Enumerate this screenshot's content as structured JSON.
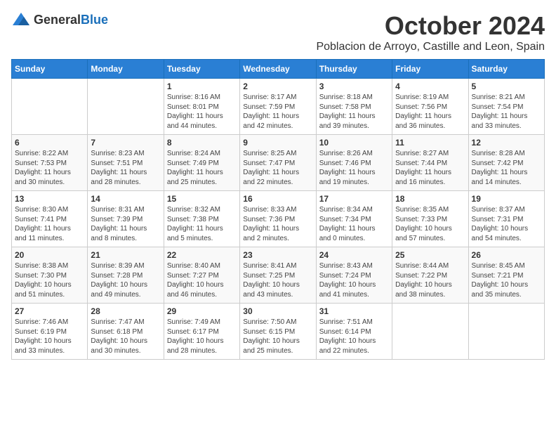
{
  "header": {
    "logo": {
      "general": "General",
      "blue": "Blue"
    },
    "month": "October 2024",
    "location": "Poblacion de Arroyo, Castille and Leon, Spain"
  },
  "weekdays": [
    "Sunday",
    "Monday",
    "Tuesday",
    "Wednesday",
    "Thursday",
    "Friday",
    "Saturday"
  ],
  "weeks": [
    [
      {
        "day": "",
        "info": ""
      },
      {
        "day": "",
        "info": ""
      },
      {
        "day": "1",
        "info": "Sunrise: 8:16 AM\nSunset: 8:01 PM\nDaylight: 11 hours\nand 44 minutes."
      },
      {
        "day": "2",
        "info": "Sunrise: 8:17 AM\nSunset: 7:59 PM\nDaylight: 11 hours\nand 42 minutes."
      },
      {
        "day": "3",
        "info": "Sunrise: 8:18 AM\nSunset: 7:58 PM\nDaylight: 11 hours\nand 39 minutes."
      },
      {
        "day": "4",
        "info": "Sunrise: 8:19 AM\nSunset: 7:56 PM\nDaylight: 11 hours\nand 36 minutes."
      },
      {
        "day": "5",
        "info": "Sunrise: 8:21 AM\nSunset: 7:54 PM\nDaylight: 11 hours\nand 33 minutes."
      }
    ],
    [
      {
        "day": "6",
        "info": "Sunrise: 8:22 AM\nSunset: 7:53 PM\nDaylight: 11 hours\nand 30 minutes."
      },
      {
        "day": "7",
        "info": "Sunrise: 8:23 AM\nSunset: 7:51 PM\nDaylight: 11 hours\nand 28 minutes."
      },
      {
        "day": "8",
        "info": "Sunrise: 8:24 AM\nSunset: 7:49 PM\nDaylight: 11 hours\nand 25 minutes."
      },
      {
        "day": "9",
        "info": "Sunrise: 8:25 AM\nSunset: 7:47 PM\nDaylight: 11 hours\nand 22 minutes."
      },
      {
        "day": "10",
        "info": "Sunrise: 8:26 AM\nSunset: 7:46 PM\nDaylight: 11 hours\nand 19 minutes."
      },
      {
        "day": "11",
        "info": "Sunrise: 8:27 AM\nSunset: 7:44 PM\nDaylight: 11 hours\nand 16 minutes."
      },
      {
        "day": "12",
        "info": "Sunrise: 8:28 AM\nSunset: 7:42 PM\nDaylight: 11 hours\nand 14 minutes."
      }
    ],
    [
      {
        "day": "13",
        "info": "Sunrise: 8:30 AM\nSunset: 7:41 PM\nDaylight: 11 hours\nand 11 minutes."
      },
      {
        "day": "14",
        "info": "Sunrise: 8:31 AM\nSunset: 7:39 PM\nDaylight: 11 hours\nand 8 minutes."
      },
      {
        "day": "15",
        "info": "Sunrise: 8:32 AM\nSunset: 7:38 PM\nDaylight: 11 hours\nand 5 minutes."
      },
      {
        "day": "16",
        "info": "Sunrise: 8:33 AM\nSunset: 7:36 PM\nDaylight: 11 hours\nand 2 minutes."
      },
      {
        "day": "17",
        "info": "Sunrise: 8:34 AM\nSunset: 7:34 PM\nDaylight: 11 hours\nand 0 minutes."
      },
      {
        "day": "18",
        "info": "Sunrise: 8:35 AM\nSunset: 7:33 PM\nDaylight: 10 hours\nand 57 minutes."
      },
      {
        "day": "19",
        "info": "Sunrise: 8:37 AM\nSunset: 7:31 PM\nDaylight: 10 hours\nand 54 minutes."
      }
    ],
    [
      {
        "day": "20",
        "info": "Sunrise: 8:38 AM\nSunset: 7:30 PM\nDaylight: 10 hours\nand 51 minutes."
      },
      {
        "day": "21",
        "info": "Sunrise: 8:39 AM\nSunset: 7:28 PM\nDaylight: 10 hours\nand 49 minutes."
      },
      {
        "day": "22",
        "info": "Sunrise: 8:40 AM\nSunset: 7:27 PM\nDaylight: 10 hours\nand 46 minutes."
      },
      {
        "day": "23",
        "info": "Sunrise: 8:41 AM\nSunset: 7:25 PM\nDaylight: 10 hours\nand 43 minutes."
      },
      {
        "day": "24",
        "info": "Sunrise: 8:43 AM\nSunset: 7:24 PM\nDaylight: 10 hours\nand 41 minutes."
      },
      {
        "day": "25",
        "info": "Sunrise: 8:44 AM\nSunset: 7:22 PM\nDaylight: 10 hours\nand 38 minutes."
      },
      {
        "day": "26",
        "info": "Sunrise: 8:45 AM\nSunset: 7:21 PM\nDaylight: 10 hours\nand 35 minutes."
      }
    ],
    [
      {
        "day": "27",
        "info": "Sunrise: 7:46 AM\nSunset: 6:19 PM\nDaylight: 10 hours\nand 33 minutes."
      },
      {
        "day": "28",
        "info": "Sunrise: 7:47 AM\nSunset: 6:18 PM\nDaylight: 10 hours\nand 30 minutes."
      },
      {
        "day": "29",
        "info": "Sunrise: 7:49 AM\nSunset: 6:17 PM\nDaylight: 10 hours\nand 28 minutes."
      },
      {
        "day": "30",
        "info": "Sunrise: 7:50 AM\nSunset: 6:15 PM\nDaylight: 10 hours\nand 25 minutes."
      },
      {
        "day": "31",
        "info": "Sunrise: 7:51 AM\nSunset: 6:14 PM\nDaylight: 10 hours\nand 22 minutes."
      },
      {
        "day": "",
        "info": ""
      },
      {
        "day": "",
        "info": ""
      }
    ]
  ]
}
